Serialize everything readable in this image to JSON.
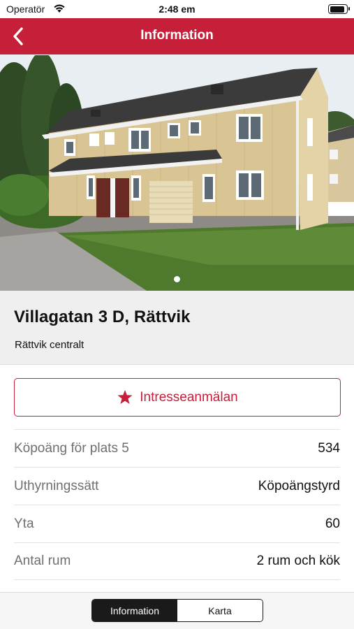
{
  "status_bar": {
    "carrier": "Operatör",
    "time": "2:48 em",
    "battery_level": 0.95
  },
  "nav": {
    "title": "Information",
    "back_icon": "chevron-left-icon"
  },
  "photo": {
    "description_icon": "photo",
    "page_count": 1,
    "current_page": 1
  },
  "listing": {
    "address": "Villagatan 3 D, Rättvik",
    "area": "Rättvik centralt"
  },
  "interest_button": {
    "icon": "star-icon",
    "label": "Intresseanmälan"
  },
  "details": [
    {
      "label": "Köpoäng för plats 5",
      "value": "534"
    },
    {
      "label": "Uthyrningssätt",
      "value": "Köpoängstyrd"
    },
    {
      "label": "Yta",
      "value": "60"
    },
    {
      "label": "Antal rum",
      "value": "2 rum och kök"
    }
  ],
  "segmented_control": {
    "options": [
      "Information",
      "Karta"
    ],
    "selected": "Information"
  },
  "colors": {
    "brand_red": "#c51f3a",
    "header_bg": "#efefef",
    "segment_dark": "#1a1a1a"
  }
}
